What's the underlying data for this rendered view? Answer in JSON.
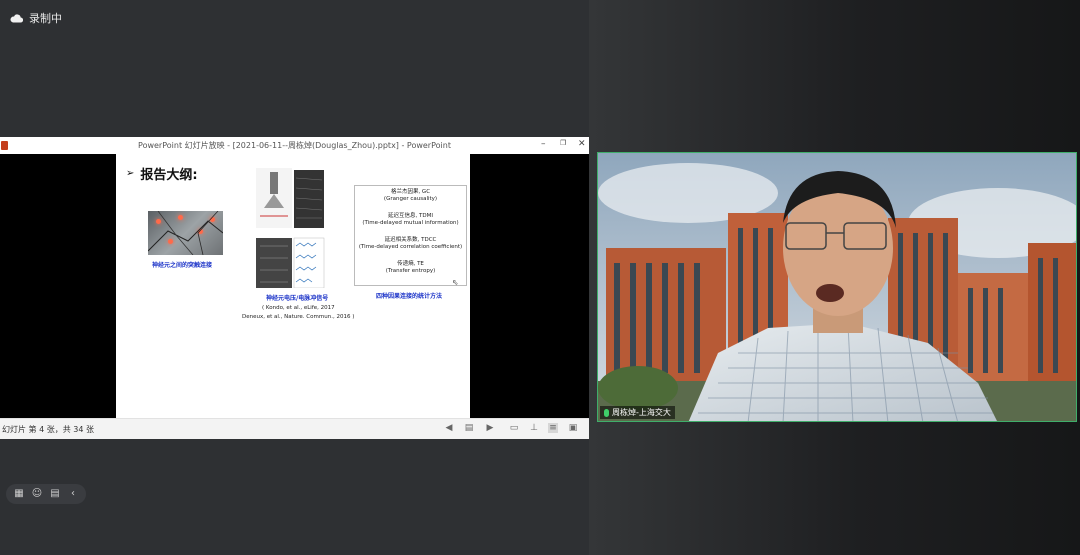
{
  "recording": {
    "label": "录制中"
  },
  "ppt": {
    "window_title": "PowerPoint 幻灯片放映 - [2021-06-11--周栋焯(Douglas_Zhou).pptx] - PowerPoint",
    "minimize": "–",
    "restore": "❐",
    "close": "✕",
    "status": "幻灯片 第 4 张，共 34 张"
  },
  "slide": {
    "heading_bullet": "➢",
    "heading": "报告大纲:",
    "caption_synapse": "神经元之间的突触连接",
    "caption_signals": "神经元电压/电脉冲信号",
    "ref_line1": "( Kondo, et al., eLife, 2017",
    "ref_line2": "Deneux, et al., Nature. Commun., 2016 )",
    "methods": [
      {
        "name": "格兰杰因果, GC",
        "desc": "(Granger causality)"
      },
      {
        "name": "延迟互信息, TDMI",
        "desc": "(Time-delayed mutual information)"
      },
      {
        "name": "延迟相关系数, TDCC",
        "desc": "(Time-delayed correlation coefficient)"
      },
      {
        "name": "传递熵, TE",
        "desc": "(Transfer entropy)"
      }
    ],
    "caption_methods": "四种因果连接的统计方法"
  },
  "video": {
    "name_tag": "周栋焯-上海交大"
  },
  "icons": [
    "cloud-icon",
    "grid-icon",
    "emoji-icon",
    "chat-icon",
    "chevron-left-icon",
    "mic-icon"
  ]
}
